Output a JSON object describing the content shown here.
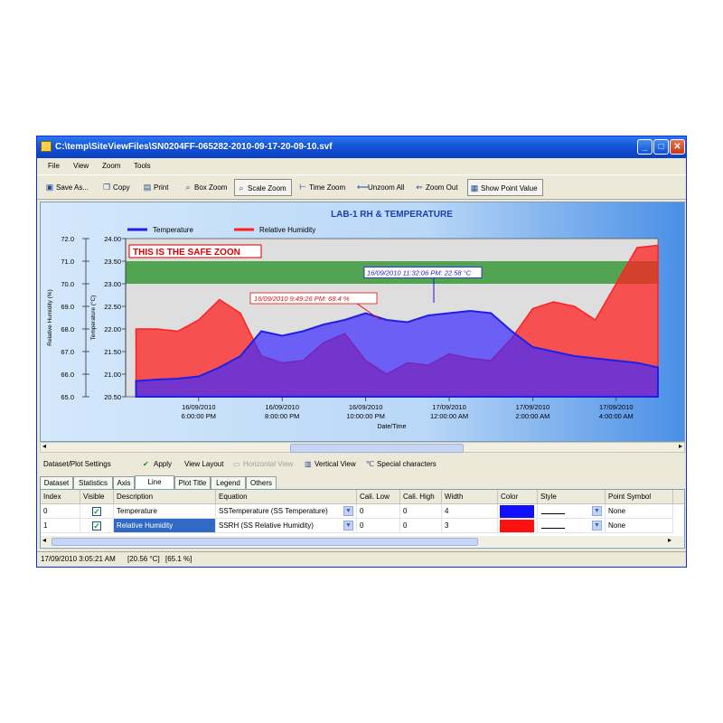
{
  "window": {
    "title": "C:\\temp\\SiteViewFiles\\SN0204FF-065282-2010-09-17-20-09-10.svf",
    "controls": {
      "minimize": "_",
      "maximize": "□",
      "close": "✕"
    }
  },
  "menu": [
    "File",
    "View",
    "Zoom",
    "Tools"
  ],
  "toolbar": [
    {
      "label": "Save As...",
      "icon": "save-icon"
    },
    {
      "label": "Copy",
      "icon": "copy-icon"
    },
    {
      "label": "Print",
      "icon": "print-icon"
    },
    {
      "label": "Box Zoom",
      "icon": "box-zoom-icon"
    },
    {
      "label": "Scale Zoom",
      "icon": "magnifier-icon",
      "pressed": true
    },
    {
      "label": "Time Zoom",
      "icon": "time-zoom-icon"
    },
    {
      "label": "Unzoom All",
      "icon": "unzoom-icon"
    },
    {
      "label": "Zoom Out",
      "icon": "zoom-out-icon"
    },
    {
      "label": "Show Point Value",
      "icon": "point-value-icon",
      "pressed": true
    }
  ],
  "chart_data": {
    "type": "area",
    "title": "LAB-1 RH & TEMPERATURE",
    "xlabel": "Date/Time",
    "y_left_outer_label": "Relative Humidity (%)",
    "y_left_inner_label": "Temperature (°C)",
    "y_rh_ticks": [
      "72.0",
      "71.0",
      "70.0",
      "69.0",
      "68.0",
      "67.0",
      "66.0",
      "65.0"
    ],
    "y_temp_ticks": [
      "24.00",
      "23.50",
      "23.00",
      "22.50",
      "22.00",
      "21.50",
      "21.00",
      "20.50"
    ],
    "ylim_rh": [
      65,
      72
    ],
    "ylim_temp": [
      20.5,
      24.0
    ],
    "x_ticks": [
      {
        "date": "16/09/2010",
        "time": "6:00:00 PM"
      },
      {
        "date": "16/09/2010",
        "time": "8:00:00 PM"
      },
      {
        "date": "16/09/2010",
        "time": "10:00:00 PM"
      },
      {
        "date": "17/09/2010",
        "time": "12:00:00 AM"
      },
      {
        "date": "17/09/2010",
        "time": "2:00:00 AM"
      },
      {
        "date": "17/09/2010",
        "time": "4:00:00 AM"
      }
    ],
    "safe_zone": {
      "label": "THIS IS THE SAFE ZOON",
      "temp_range": [
        23.0,
        23.5
      ],
      "color": "#3a9a3a"
    },
    "annotations": [
      {
        "text": "16/09/2010 11:32:06 PM: 22.58 °C",
        "series": "Temperature",
        "color": "#1a1ad0"
      },
      {
        "text": "16/09/2010 9:49:26 PM: 68.4 %",
        "series": "Relative Humidity",
        "color": "#e01010"
      }
    ],
    "series": [
      {
        "name": "Temperature",
        "color": "#1f1fe6",
        "unit": "°C",
        "x": [
          "16/09/2010 16:30",
          "16/09/2010 17:00",
          "16/09/2010 17:30",
          "16/09/2010 18:00",
          "16/09/2010 18:30",
          "16/09/2010 19:00",
          "16/09/2010 19:30",
          "16/09/2010 20:00",
          "16/09/2010 20:30",
          "16/09/2010 21:00",
          "16/09/2010 21:30",
          "16/09/2010 22:00",
          "16/09/2010 22:30",
          "16/09/2010 23:00",
          "16/09/2010 23:30",
          "17/09/2010 00:00",
          "17/09/2010 00:30",
          "17/09/2010 01:00",
          "17/09/2010 01:30",
          "17/09/2010 02:00",
          "17/09/2010 02:30",
          "17/09/2010 03:00",
          "17/09/2010 03:30",
          "17/09/2010 04:00",
          "17/09/2010 04:30",
          "17/09/2010 05:00"
        ],
        "values": [
          20.85,
          20.88,
          20.9,
          20.95,
          21.15,
          21.4,
          21.95,
          21.85,
          21.95,
          22.1,
          22.2,
          22.35,
          22.2,
          22.15,
          22.3,
          22.35,
          22.4,
          22.35,
          21.95,
          21.6,
          21.5,
          21.4,
          21.35,
          21.3,
          21.25,
          21.15
        ]
      },
      {
        "name": "Relative Humidity",
        "color": "#ff2020",
        "unit": "%",
        "x": [
          "16/09/2010 16:30",
          "16/09/2010 17:00",
          "16/09/2010 17:30",
          "16/09/2010 18:00",
          "16/09/2010 18:30",
          "16/09/2010 19:00",
          "16/09/2010 19:30",
          "16/09/2010 20:00",
          "16/09/2010 20:30",
          "16/09/2010 21:00",
          "16/09/2010 21:30",
          "16/09/2010 22:00",
          "16/09/2010 22:30",
          "16/09/2010 23:00",
          "16/09/2010 23:30",
          "17/09/2010 00:00",
          "17/09/2010 00:30",
          "17/09/2010 01:00",
          "17/09/2010 01:30",
          "17/09/2010 02:00",
          "17/09/2010 02:30",
          "17/09/2010 03:00",
          "17/09/2010 03:30",
          "17/09/2010 04:00",
          "17/09/2010 04:30",
          "17/09/2010 05:00"
        ],
        "values": [
          68.0,
          68.0,
          67.9,
          68.4,
          69.3,
          68.7,
          66.8,
          66.5,
          66.6,
          67.4,
          67.8,
          66.6,
          66.0,
          66.5,
          66.4,
          66.9,
          66.7,
          66.6,
          67.6,
          68.9,
          69.2,
          69.0,
          68.4,
          70.0,
          71.6,
          71.7
        ]
      }
    ],
    "legend_position": "top",
    "grid": false
  },
  "settings_bar": {
    "title": "Dataset/Plot Settings",
    "apply": "Apply",
    "view_layout": "View Layout",
    "horizontal_view": "Horizontal View",
    "vertical_view": "Vertical View",
    "special_characters": "Special characters"
  },
  "tabs": [
    "Dataset",
    "Statistics",
    "Axis",
    "Line",
    "Plot Title",
    "Legend",
    "Others"
  ],
  "active_tab": "Line",
  "table": {
    "columns": [
      "Index",
      "Visible",
      "Description",
      "Equation",
      "Cali. Low",
      "Cali. High",
      "Width",
      "Color",
      "Style",
      "Point Symbol"
    ],
    "rows": [
      {
        "index": "0",
        "visible": true,
        "description": "Temperature",
        "equation": "SSTemperature (SS Temperature)",
        "cali_low": "0",
        "cali_high": "0",
        "width": "4",
        "color": "#1010ff",
        "point_symbol": "None"
      },
      {
        "index": "1",
        "visible": true,
        "description": "Relative Humidity",
        "equation": "SSRH (SS Relative Humidity)",
        "cali_low": "0",
        "cali_high": "0",
        "width": "3",
        "color": "#ff1010",
        "point_symbol": "None"
      }
    ]
  },
  "status": {
    "time": "17/09/2010 3:05:21 AM",
    "temp": "[20.56 °C]",
    "rh": "[65.1 %]"
  }
}
